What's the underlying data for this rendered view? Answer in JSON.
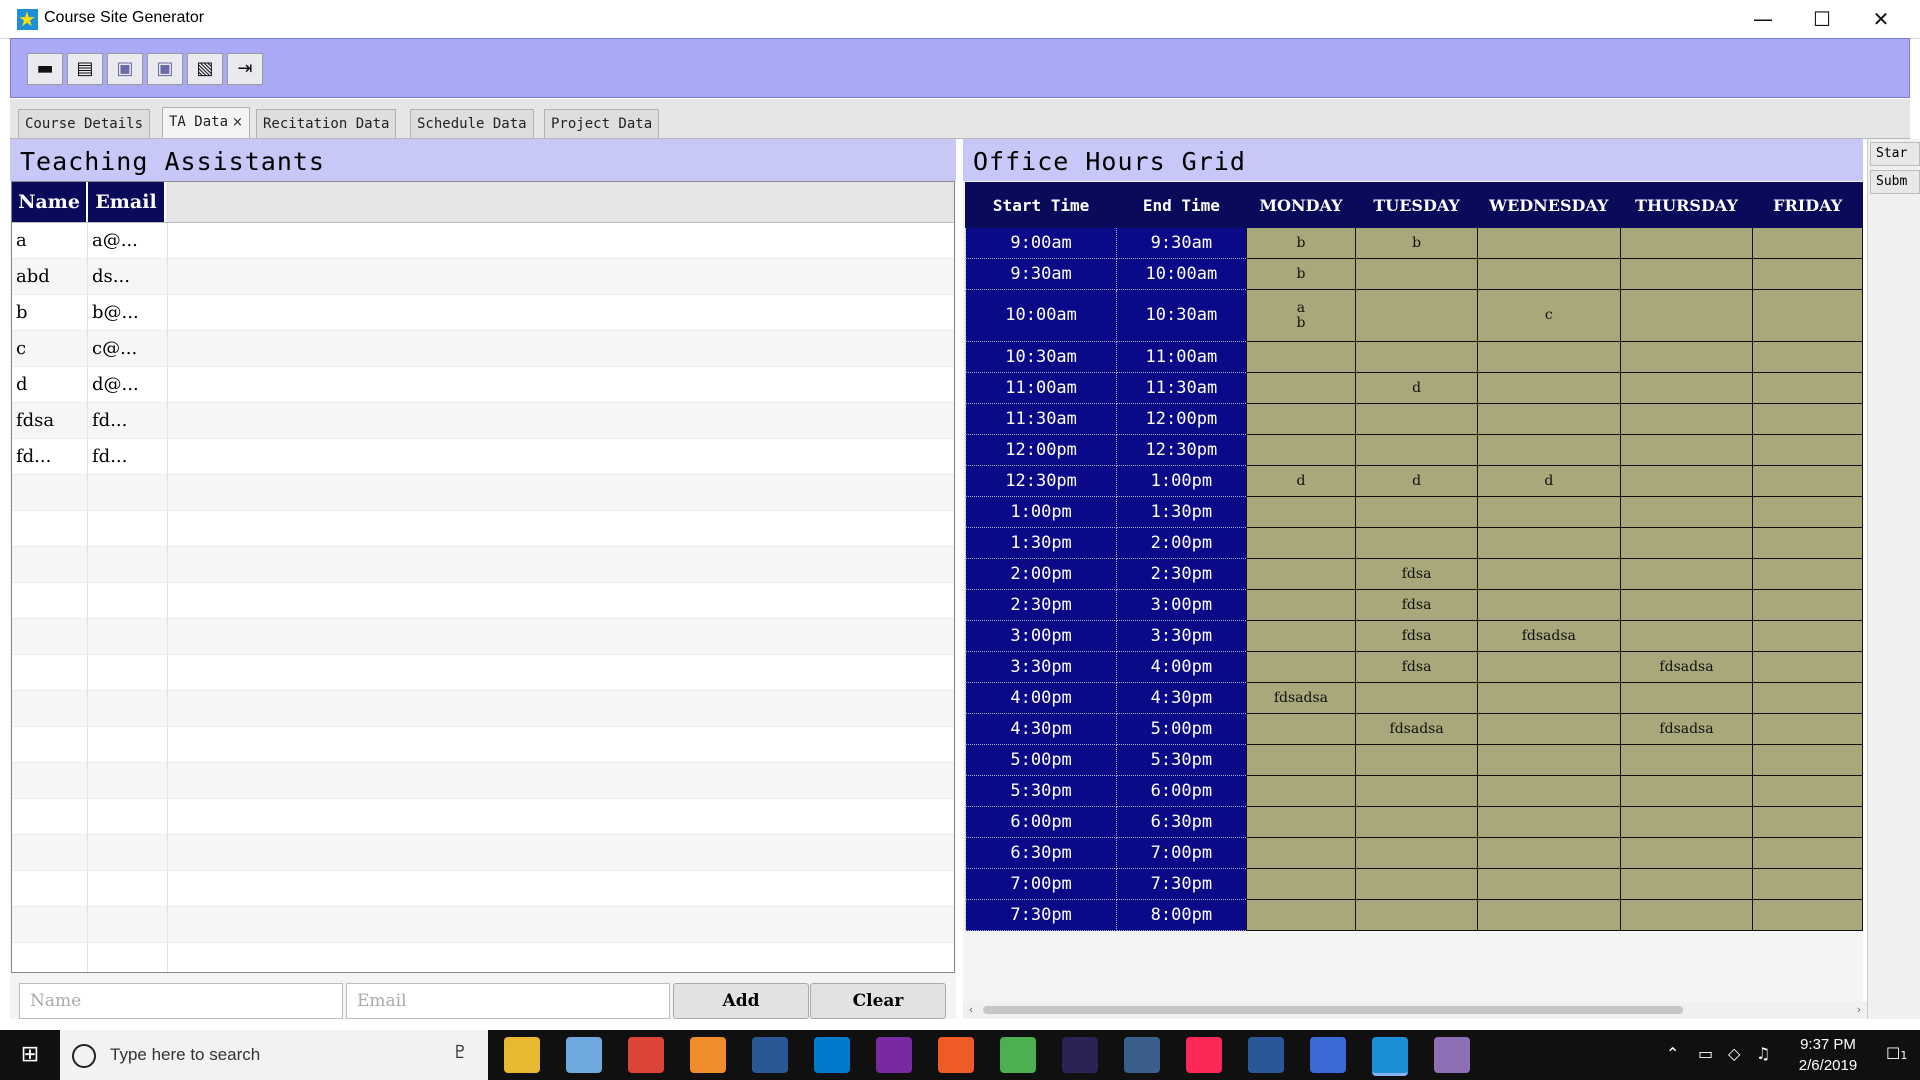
{
  "window": {
    "title": "Course Site Generator",
    "minimize": "—",
    "maximize": "☐",
    "close": "✕"
  },
  "toolbar": {
    "buttons": [
      {
        "name": "new-button",
        "icon": "▬"
      },
      {
        "name": "open-button",
        "icon": "▤"
      },
      {
        "name": "save-button",
        "icon": "▣"
      },
      {
        "name": "save-as-button",
        "icon": "▣"
      },
      {
        "name": "export-button",
        "icon": "▧"
      },
      {
        "name": "exit-button",
        "icon": "⇥"
      }
    ]
  },
  "tabs": [
    {
      "label": "Course Details"
    },
    {
      "label": "TA Data",
      "close": "×"
    },
    {
      "label": "Recitation Data"
    },
    {
      "label": "Schedule Data"
    },
    {
      "label": "Project Data"
    }
  ],
  "ta_panel": {
    "title": "Teaching Assistants",
    "columns": [
      "Name",
      "Email"
    ],
    "rows": [
      {
        "name": "a",
        "email": "a@..."
      },
      {
        "name": "abd",
        "email": "ds..."
      },
      {
        "name": "b",
        "email": "b@..."
      },
      {
        "name": "c",
        "email": "c@..."
      },
      {
        "name": "d",
        "email": "d@..."
      },
      {
        "name": "fdsa",
        "email": "fd..."
      },
      {
        "name": "fd...",
        "email": "fd..."
      }
    ],
    "name_placeholder": "Name",
    "email_placeholder": "Email",
    "add_label": "Add",
    "clear_label": "Clear"
  },
  "office_hours": {
    "title": "Office Hours Grid",
    "columns": [
      "Start Time",
      "End Time",
      "MONDAY",
      "TUESDAY",
      "WEDNESDAY",
      "THURSDAY",
      "FRIDAY"
    ],
    "rows": [
      {
        "start": "9:00am",
        "end": "9:30am",
        "cells": [
          "b",
          "b",
          "",
          "",
          ""
        ]
      },
      {
        "start": "9:30am",
        "end": "10:00am",
        "cells": [
          "b",
          "",
          "",
          "",
          ""
        ]
      },
      {
        "start": "10:00am",
        "end": "10:30am",
        "cells": [
          "a\nb",
          "",
          "c",
          "",
          ""
        ],
        "tall": true
      },
      {
        "start": "10:30am",
        "end": "11:00am",
        "cells": [
          "",
          "",
          "",
          "",
          ""
        ]
      },
      {
        "start": "11:00am",
        "end": "11:30am",
        "cells": [
          "",
          "d",
          "",
          "",
          ""
        ]
      },
      {
        "start": "11:30am",
        "end": "12:00pm",
        "cells": [
          "",
          "",
          "",
          "",
          ""
        ]
      },
      {
        "start": "12:00pm",
        "end": "12:30pm",
        "cells": [
          "",
          "",
          "",
          "",
          ""
        ]
      },
      {
        "start": "12:30pm",
        "end": "1:00pm",
        "cells": [
          "d",
          "d",
          "d",
          "",
          ""
        ]
      },
      {
        "start": "1:00pm",
        "end": "1:30pm",
        "cells": [
          "",
          "",
          "",
          "",
          ""
        ]
      },
      {
        "start": "1:30pm",
        "end": "2:00pm",
        "cells": [
          "",
          "",
          "",
          "",
          ""
        ]
      },
      {
        "start": "2:00pm",
        "end": "2:30pm",
        "cells": [
          "",
          "fdsa",
          "",
          "",
          ""
        ]
      },
      {
        "start": "2:30pm",
        "end": "3:00pm",
        "cells": [
          "",
          "fdsa",
          "",
          "",
          ""
        ]
      },
      {
        "start": "3:00pm",
        "end": "3:30pm",
        "cells": [
          "",
          "fdsa",
          "fdsadsa",
          "",
          ""
        ]
      },
      {
        "start": "3:30pm",
        "end": "4:00pm",
        "cells": [
          "",
          "fdsa",
          "",
          "fdsadsa",
          ""
        ]
      },
      {
        "start": "4:00pm",
        "end": "4:30pm",
        "cells": [
          "fdsadsa",
          "",
          "",
          "",
          ""
        ]
      },
      {
        "start": "4:30pm",
        "end": "5:00pm",
        "cells": [
          "",
          "fdsadsa",
          "",
          "fdsadsa",
          ""
        ]
      },
      {
        "start": "5:00pm",
        "end": "5:30pm",
        "cells": [
          "",
          "",
          "",
          "",
          ""
        ]
      },
      {
        "start": "5:30pm",
        "end": "6:00pm",
        "cells": [
          "",
          "",
          "",
          "",
          ""
        ]
      },
      {
        "start": "6:00pm",
        "end": "6:30pm",
        "cells": [
          "",
          "",
          "",
          "",
          ""
        ]
      },
      {
        "start": "6:30pm",
        "end": "7:00pm",
        "cells": [
          "",
          "",
          "",
          "",
          ""
        ]
      },
      {
        "start": "7:00pm",
        "end": "7:30pm",
        "cells": [
          "",
          "",
          "",
          "",
          ""
        ]
      },
      {
        "start": "7:30pm",
        "end": "8:00pm",
        "cells": [
          "",
          "",
          "",
          "",
          ""
        ]
      }
    ]
  },
  "right_edge": {
    "btn1": "Star",
    "btn2": "Subm"
  },
  "scrollbar": {
    "left": "‹",
    "right": "›"
  },
  "taskbar": {
    "start_icon": "⊞",
    "search_placeholder": "Type here to search",
    "mic_icon": "♇",
    "apps": [
      {
        "name": "file-explorer-app",
        "color": "#e8b830"
      },
      {
        "name": "box-app",
        "color": "#6fa8dc"
      },
      {
        "name": "chrome-app",
        "color": "#db4437"
      },
      {
        "name": "sublime-app",
        "color": "#f08c2c"
      },
      {
        "name": "powershell-app",
        "color": "#2b5797"
      },
      {
        "name": "vscode-app",
        "color": "#007acc"
      },
      {
        "name": "onenote-app",
        "color": "#7a2aa0"
      },
      {
        "name": "postman-app",
        "color": "#ef5b25"
      },
      {
        "name": "leaf-app",
        "color": "#4caf50"
      },
      {
        "name": "eclipse-app",
        "color": "#2c2255"
      },
      {
        "name": "workbench-app",
        "color": "#3a5f8a"
      },
      {
        "name": "intellij-app",
        "color": "#fe2857"
      },
      {
        "name": "word-app",
        "color": "#2b579a"
      },
      {
        "name": "alien-app",
        "color": "#3b6ad6"
      },
      {
        "name": "course-site-generator-app",
        "color": "#1b8fd8",
        "active": true
      },
      {
        "name": "paint-app",
        "color": "#8c6fb5"
      }
    ],
    "clock_time": "9:37 PM",
    "clock_date": "2/6/2019",
    "notifications": "1"
  }
}
